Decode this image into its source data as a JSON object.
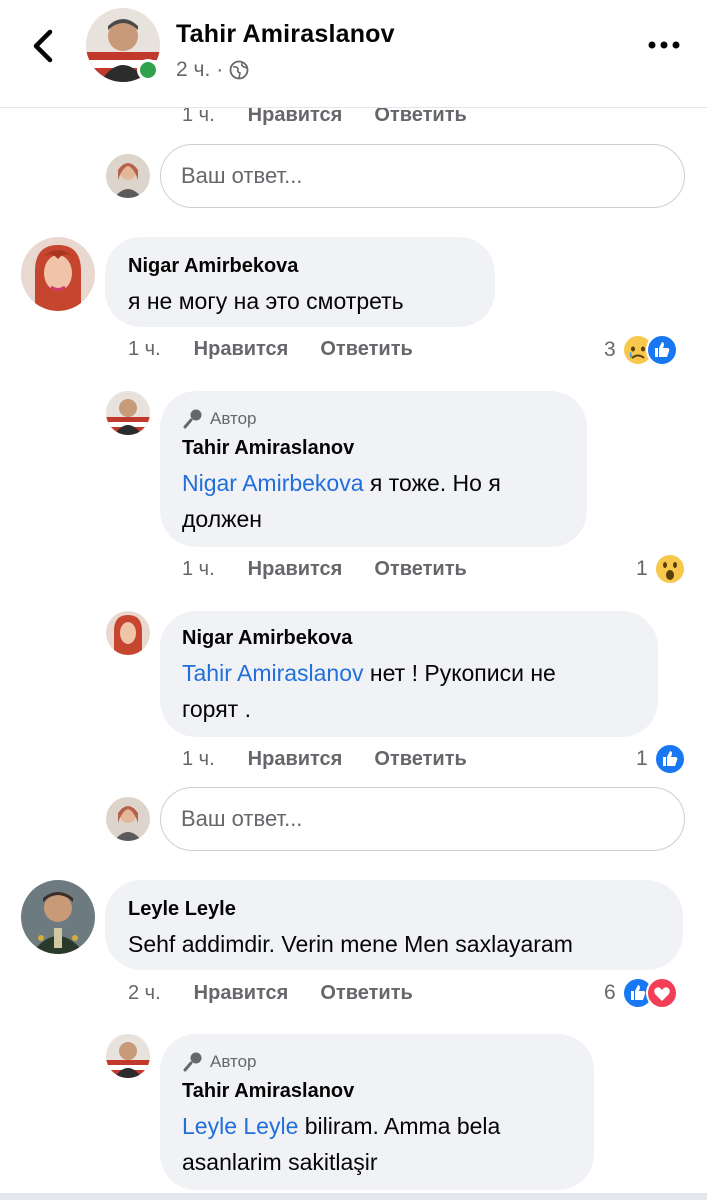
{
  "header": {
    "name": "Tahir Amiraslanov",
    "time": "2 ч.",
    "dot": "·",
    "icons": [
      "back-icon",
      "globe-icon",
      "more-icon"
    ]
  },
  "labels": {
    "like": "Нравится",
    "reply": "Ответить",
    "author": "Автор",
    "reply_placeholder": "Ваш ответ..."
  },
  "top_actions": {
    "time": "1 ч."
  },
  "comments": [
    {
      "name": "Nigar Amirbekova",
      "text": "я не  могу на это смотреть",
      "time": "1 ч.",
      "reaction_count": "3",
      "reactions": [
        "sad",
        "like"
      ]
    },
    {
      "name": "Tahir Amiraslanov",
      "mention": "Nigar Amirbekova",
      "text_line1": " я тоже. Но я",
      "text_line2": "должен",
      "time": "1 ч.",
      "reaction_count": "1",
      "reactions": [
        "wow"
      ]
    },
    {
      "name": "Nigar Amirbekova",
      "mention": "Tahir Amiraslanov",
      "text_line1": " нет ! Рукописи не",
      "text_line2": "горят .",
      "time": "1 ч.",
      "reaction_count": "1",
      "reactions": [
        "like"
      ]
    },
    {
      "name": "Leyle Leyle",
      "text": "Sehf addimdir. Verin mene Men saxlayaram",
      "time": "2 ч.",
      "reaction_count": "6",
      "reactions": [
        "like",
        "love"
      ]
    },
    {
      "name": "Tahir Amiraslanov",
      "mention": "Leyle Leyle",
      "text_line1": "  biliram. Amma bela",
      "text_line2": "asanlarim sakitlaşir"
    }
  ],
  "colors": {
    "mention": "#216fdb",
    "bubble": "#f0f2f5",
    "meta": "#65676b",
    "like_blue": "#1877f2",
    "love_red": "#f33e58",
    "online": "#31a24c"
  }
}
